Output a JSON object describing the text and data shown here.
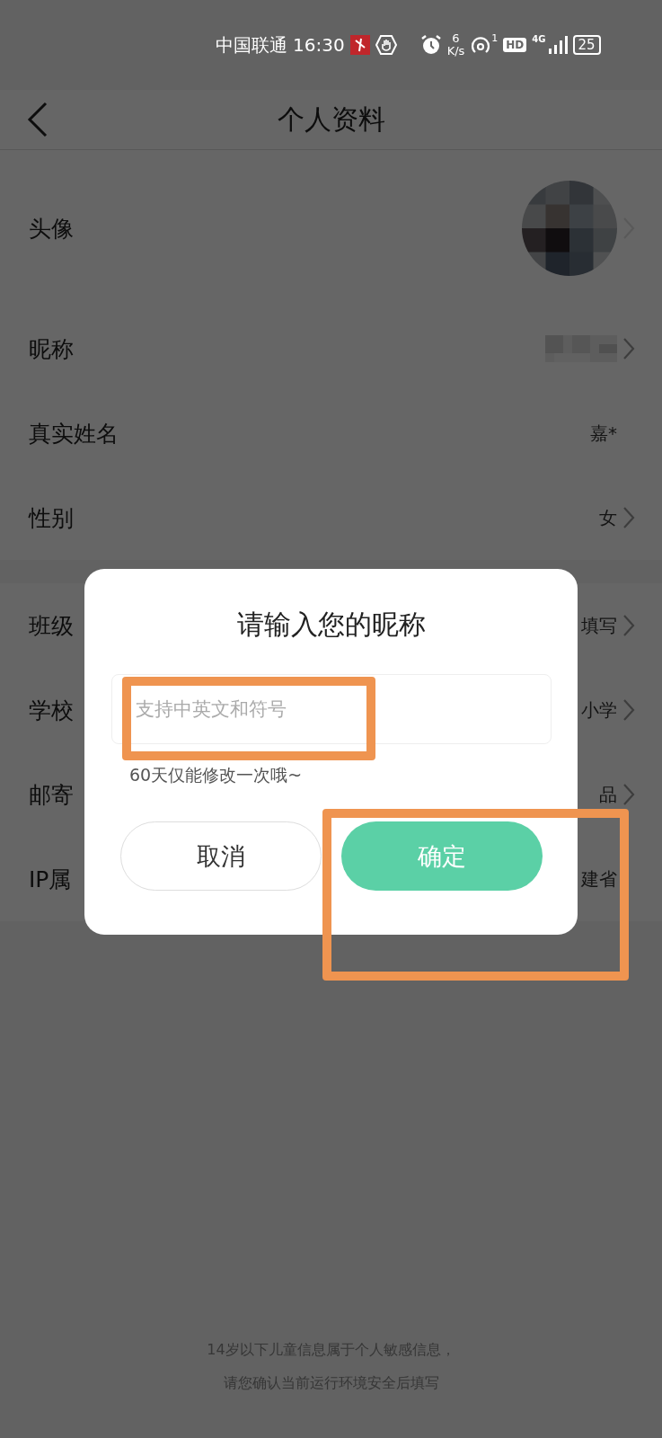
{
  "status_bar": {
    "carrier": "中国联通",
    "time": "16:30",
    "net_speed_value": "6",
    "net_speed_unit": "K/s",
    "hotspot_count": "1",
    "hd": "HD",
    "network": "4G",
    "battery": "25"
  },
  "header": {
    "title": "个人资料"
  },
  "sections": [
    {
      "rows": [
        {
          "kind": "avatar",
          "label": "头像",
          "arrow": true
        },
        {
          "kind": "blurred",
          "label": "昵称",
          "arrow": true
        },
        {
          "kind": "text",
          "label": "真实姓名",
          "value": "嘉*",
          "arrow": false
        },
        {
          "kind": "text",
          "label": "性别",
          "value": "女",
          "arrow": true
        }
      ]
    },
    {
      "rows": [
        {
          "kind": "text",
          "label": "班级",
          "value": "填写",
          "arrow": true
        },
        {
          "kind": "text",
          "label": "学校",
          "value": "小学",
          "arrow": true
        },
        {
          "kind": "text",
          "label": "邮寄",
          "value": "品",
          "arrow": true
        },
        {
          "kind": "text",
          "label": "IP属",
          "value": "建省",
          "arrow": false
        }
      ]
    }
  ],
  "footer": {
    "lines": [
      "14岁以下儿童信息属于个人敏感信息，",
      "请您确认当前运行环境安全后填写"
    ]
  },
  "dialog": {
    "title": "请输入您的昵称",
    "input": {
      "placeholder": "支持中英文和符号"
    },
    "hint": "60天仅能修改一次哦~",
    "buttons": [
      {
        "label": "取消",
        "kind": "secondary"
      },
      {
        "label": "确定",
        "kind": "primary"
      }
    ]
  }
}
